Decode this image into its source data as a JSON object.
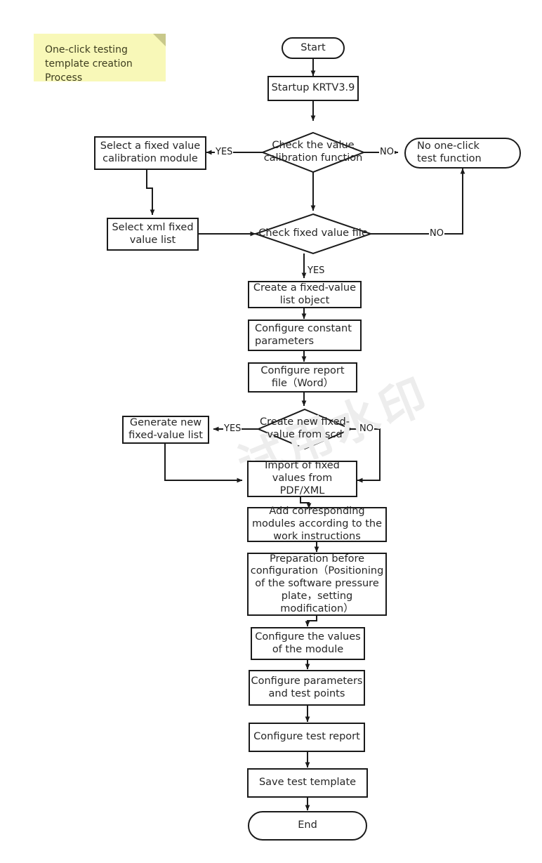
{
  "diagram": {
    "title_note": {
      "line1": "One-click testing",
      "line2": "template creation Process"
    },
    "watermark": "试用水印",
    "colors": {
      "note_fill": "#f8f8b8",
      "node_stroke": "#1a1a1a",
      "node_fill": "#ffffff",
      "text": "#262626",
      "watermark": "#ededed"
    },
    "nodes": [
      {
        "id": "start",
        "type": "terminator",
        "label": "Start"
      },
      {
        "id": "startup",
        "type": "process",
        "label": "Startup KRTV3.9"
      },
      {
        "id": "check_value_calib",
        "type": "decision",
        "line1": "Check the value",
        "line2": "calibration function"
      },
      {
        "id": "select_calib_module",
        "type": "process",
        "line1": "Select a fixed value",
        "line2": "calibration module"
      },
      {
        "id": "no_oneclick",
        "type": "terminator",
        "line1": "No one-click",
        "line2": "test function"
      },
      {
        "id": "select_xml_list",
        "type": "process",
        "line1": "Select xml fixed",
        "line2": "value list"
      },
      {
        "id": "check_fixed_file",
        "type": "decision",
        "label": "Check fixed value file"
      },
      {
        "id": "create_list_object",
        "type": "process",
        "line1": "Create a fixed-value",
        "line2": "list object"
      },
      {
        "id": "configure_constant",
        "type": "process",
        "line1": "Configure constant",
        "line2": "parameters"
      },
      {
        "id": "configure_report_file",
        "type": "process",
        "line1": "Configure report",
        "line2": "file（Word）"
      },
      {
        "id": "create_new_from_scd",
        "type": "decision",
        "line1": "Create new fixed-",
        "line2": "value from scd"
      },
      {
        "id": "generate_new_list",
        "type": "process",
        "line1": "Generate new",
        "line2": "fixed-value list"
      },
      {
        "id": "import_fixed_values",
        "type": "process",
        "line1": "Import of fixed",
        "line2": "values from",
        "line3": "PDF/XML"
      },
      {
        "id": "add_modules",
        "type": "process",
        "line1": "Add corresponding",
        "line2": "modules according to the",
        "line3": "work instructions"
      },
      {
        "id": "preparation",
        "type": "process",
        "line1": "Preparation before",
        "line2": "configuration（Positioning",
        "line3": "of the software pressure",
        "line4": "plate，setting",
        "line5": "modification）"
      },
      {
        "id": "configure_values",
        "type": "process",
        "line1": "Configure the values",
        "line2": "of the module"
      },
      {
        "id": "configure_params",
        "type": "process",
        "line1": "Configure  parameters",
        "line2": "and test points"
      },
      {
        "id": "configure_test_report",
        "type": "process",
        "label": "Configure test report"
      },
      {
        "id": "save_template",
        "type": "process",
        "label": "Save test template"
      },
      {
        "id": "end",
        "type": "terminator",
        "label": "End"
      }
    ],
    "edge_labels": {
      "calib_yes": "YES",
      "calib_no": "NO",
      "fixedfile_no": "NO",
      "fixedfile_yes": "YES",
      "scd_yes": "YES",
      "scd_no": "NO"
    }
  }
}
